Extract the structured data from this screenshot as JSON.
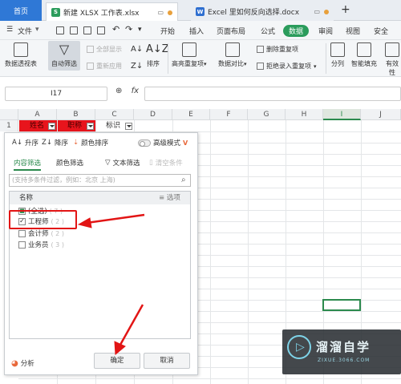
{
  "tabs": {
    "home": "首页",
    "doc1": "新建 XLSX 工作表.xlsx",
    "doc2": "Excel 里如何反向选择.docx"
  },
  "menu": {
    "file": "文件",
    "items": [
      "开始",
      "插入",
      "页面布局",
      "公式",
      "数据",
      "审阅",
      "视图",
      "安全"
    ],
    "active": "数据"
  },
  "ribbon": {
    "pivot": "数据透视表",
    "autofilter": "自动筛选",
    "show_all": "全部显示",
    "reapply": "重新应用",
    "sort": "排序",
    "highlight_dup": "高亮重复项",
    "compare": "数据对比",
    "delete_dup": "删除重复项",
    "reject_dup": "拒绝录入重复项",
    "split": "分列",
    "smart_fill": "智能填充",
    "valid": "有效性"
  },
  "formula": {
    "cell_ref": "I17",
    "fx": "fx"
  },
  "grid": {
    "columns": [
      "A",
      "B",
      "C",
      "D",
      "E",
      "F",
      "G",
      "H",
      "I",
      "J"
    ],
    "row1": "1",
    "a1": "姓名",
    "b1": "职称",
    "c1": "标识"
  },
  "filter_popup": {
    "asc": "升序",
    "desc": "降序",
    "color_sort": "颜色排序",
    "advanced": "高级模式",
    "vip": "V",
    "tab_content": "内容筛选",
    "tab_color": "颜色筛选",
    "text_filter": "文本筛选",
    "clear": "清空条件",
    "search_placeholder": "(支持多条件过滤，例如：北京 上海)",
    "header_name": "名称",
    "header_options": "选项",
    "items": [
      {
        "label": "(全选)",
        "count": "( 7 )",
        "checked": "partial"
      },
      {
        "label": "工程师",
        "count": "( 2 )",
        "checked": true
      },
      {
        "label": "会计师",
        "count": "( 2 )",
        "checked": false
      },
      {
        "label": "业务员",
        "count": "( 3 )",
        "checked": false
      }
    ],
    "analyze": "分析",
    "ok": "确定",
    "cancel": "取消"
  },
  "watermark": {
    "title": "溜溜自学",
    "sub": "ZIXUE.3066.COM"
  },
  "colors": {
    "accent_green": "#2b8a4d",
    "tab_blue": "#2f78d6",
    "red_header": "#e8141c",
    "annotation_red": "#e21515"
  }
}
